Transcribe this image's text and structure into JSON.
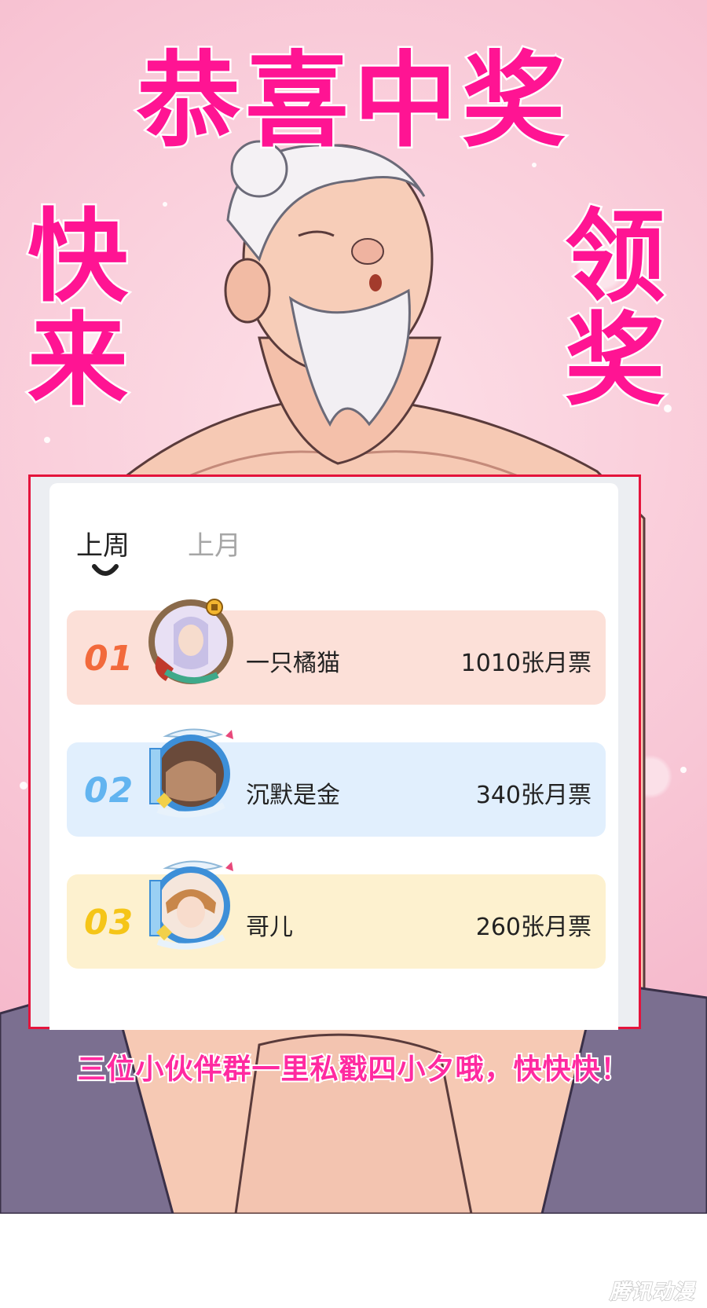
{
  "poster": {
    "headline": "恭喜中奖",
    "left_text": "快来",
    "right_text": "领奖",
    "caption": "三位小伙伴群一里私戳四小夕哦，快快快！",
    "watermark": "腾讯动漫",
    "colors": {
      "headline": "#ff1493",
      "frame": "#e4143c",
      "background": "#f8c6d5"
    }
  },
  "leaderboard": {
    "tabs": [
      {
        "label": "上周",
        "active": true
      },
      {
        "label": "上月",
        "active": false
      }
    ],
    "entries": [
      {
        "rank": "01",
        "name": "一只橘猫",
        "votes": "1010张月票",
        "rank_color": "#f26a3c",
        "row_color": "#fce0d8",
        "avatar_icon": "avatar-frame-gold-icon"
      },
      {
        "rank": "02",
        "name": "沉默是金",
        "votes": "340张月票",
        "rank_color": "#62b4f0",
        "row_color": "#e1effd",
        "avatar_icon": "avatar-frame-blue-wings-icon"
      },
      {
        "rank": "03",
        "name": "哥儿",
        "votes": "260张月票",
        "rank_color": "#f5c518",
        "row_color": "#fdf1cf",
        "avatar_icon": "avatar-frame-blue-wings-icon"
      }
    ]
  }
}
